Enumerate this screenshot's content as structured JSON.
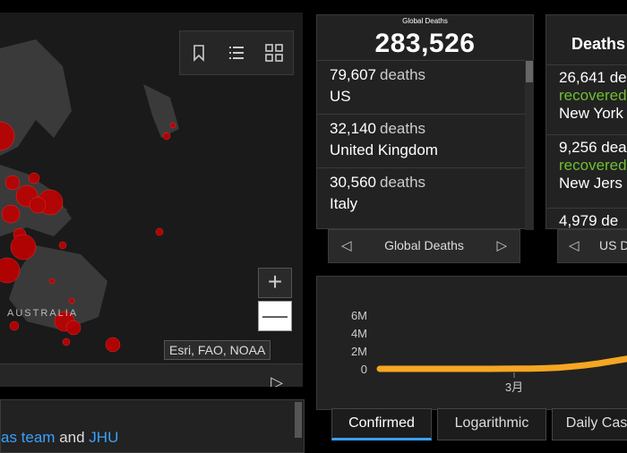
{
  "map": {
    "region_label": "AUSTRALIA",
    "attribution": "Esri, FAO, NOAA",
    "zoom_in": "+",
    "zoom_out": "—",
    "next_arrow": "▷",
    "tool_icons": [
      "bookmark-icon",
      "list-icon",
      "qr-grid-icon"
    ]
  },
  "credits": {
    "text_start": "as team",
    "text_mid": " and ",
    "text_link": "JHU"
  },
  "global": {
    "title": "Global Deaths",
    "total": "283,526",
    "items": [
      {
        "count": "79,607",
        "unit": "deaths",
        "country": "US"
      },
      {
        "count": "32,140",
        "unit": "deaths",
        "country": "United Kingdom"
      },
      {
        "count": "30,560",
        "unit": "deaths",
        "country": "Italy"
      }
    ],
    "nav_label": "Global Deaths",
    "prev": "◁",
    "next": "▷"
  },
  "us": {
    "title": "Deaths",
    "items": [
      {
        "count": "26,641 de",
        "status": "recovered",
        "state": "New York"
      },
      {
        "count": "9,256 dea",
        "status": "recovered",
        "state": "New Jers"
      },
      {
        "count": "4,979 de",
        "status": "",
        "state": ""
      }
    ],
    "nav_label": "US D",
    "prev": "◁"
  },
  "chart_data": {
    "type": "line",
    "y_ticks": [
      "6M",
      "4M",
      "2M",
      "0"
    ],
    "x_ticks": [
      "3月"
    ],
    "ylim": [
      0,
      6000000
    ],
    "series": [
      {
        "color": "#f5a623",
        "values": [
          0,
          0,
          0,
          0,
          0,
          0,
          0,
          0,
          0,
          10000,
          20000,
          30000,
          60000,
          120000,
          250000,
          400000,
          600000,
          850000,
          1100000,
          1400000
        ]
      }
    ],
    "grid": false
  },
  "tabs": [
    "Confirmed",
    "Logarithmic",
    "Daily Cas"
  ]
}
